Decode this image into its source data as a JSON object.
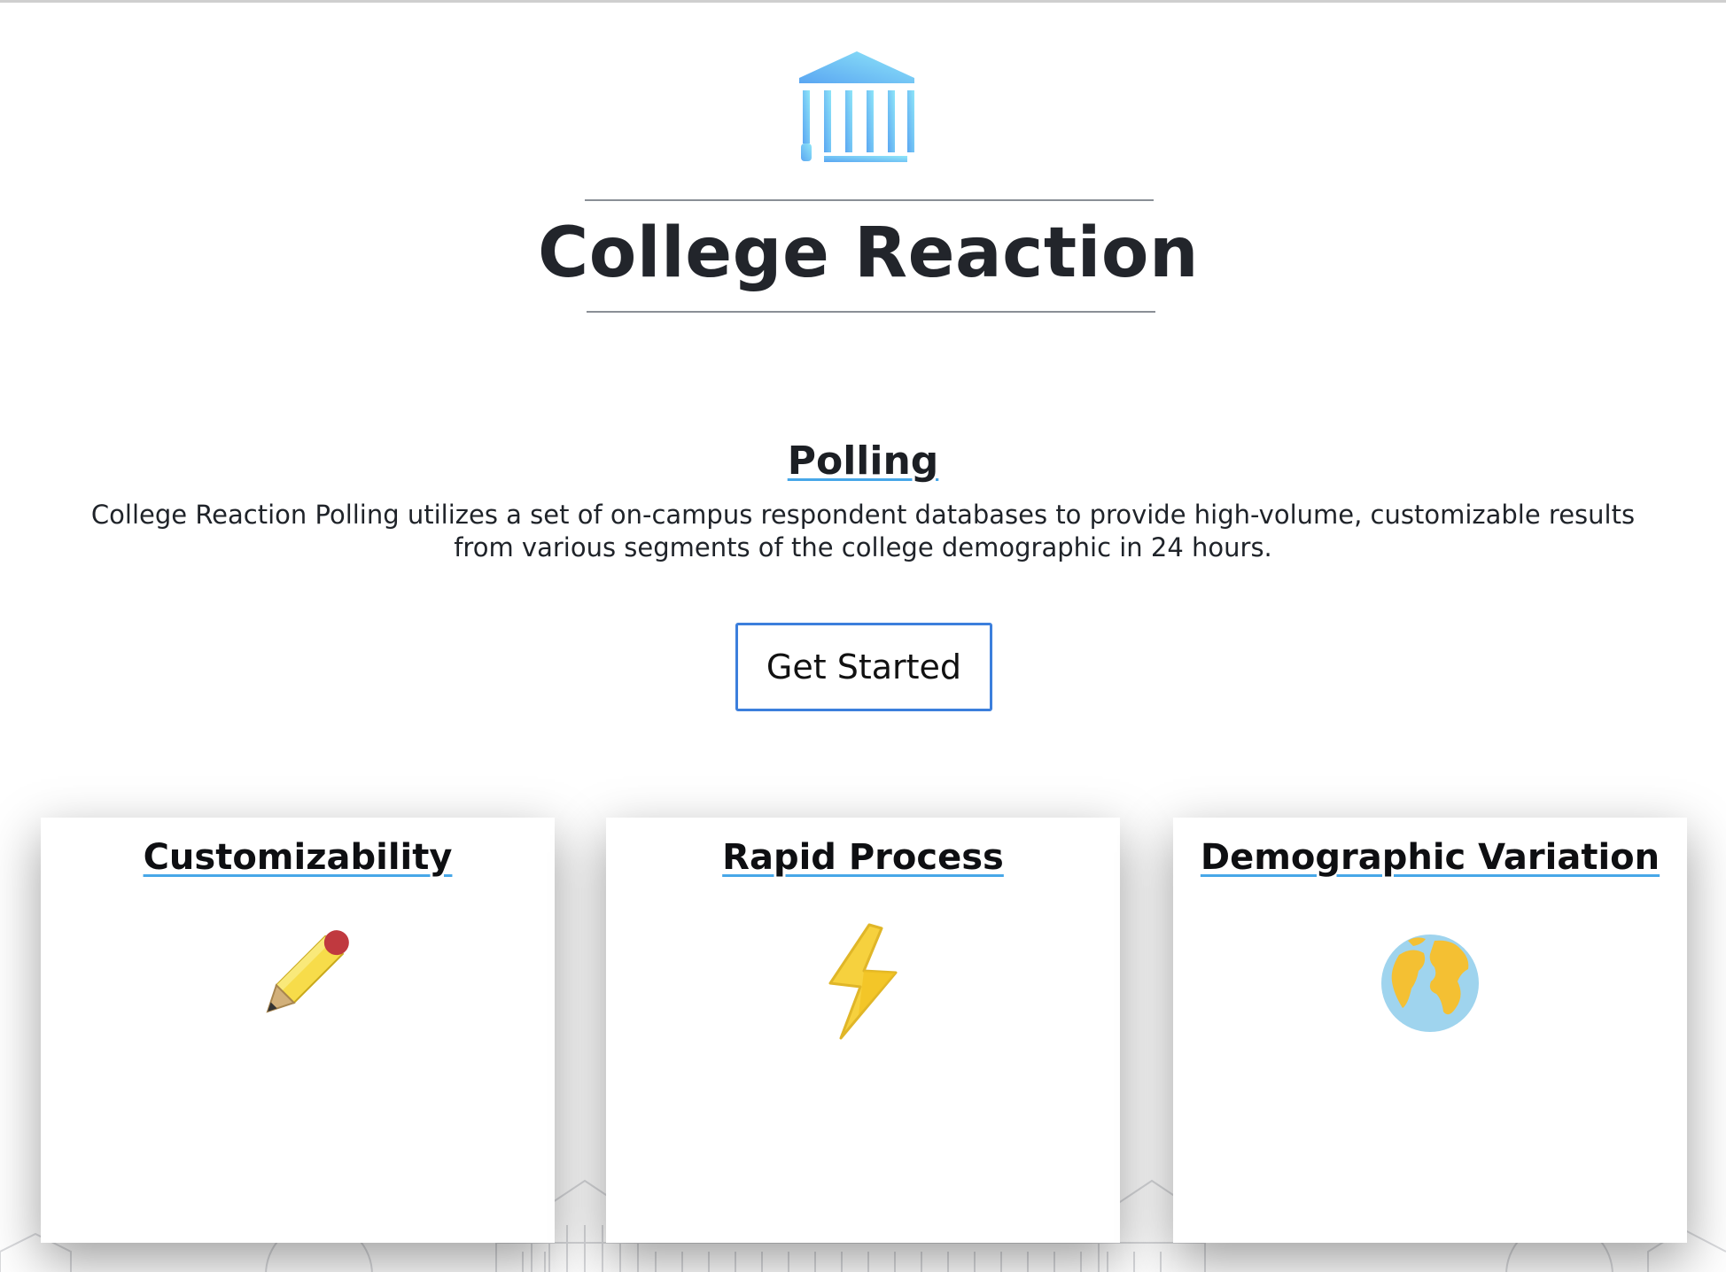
{
  "header": {
    "logo_icon": "college-building-icon",
    "title": "College Reaction"
  },
  "polling": {
    "heading": "Polling",
    "description": "College Reaction Polling utilizes a set of on-campus respondent databases to provide high-volume, customizable results from various segments of the college demographic in 24 hours.",
    "cta_label": "Get Started"
  },
  "features": [
    {
      "title": "Customizability",
      "icon": "pencil-icon"
    },
    {
      "title": "Rapid Process",
      "icon": "lightning-bolt-icon"
    },
    {
      "title": "Demographic Variation",
      "icon": "globe-icon"
    }
  ],
  "colors": {
    "accent_underline": "#47a7e8",
    "button_border": "#3c7fdc",
    "logo_gradient_start": "#5aa6f2",
    "logo_gradient_end": "#8fe6f8"
  }
}
